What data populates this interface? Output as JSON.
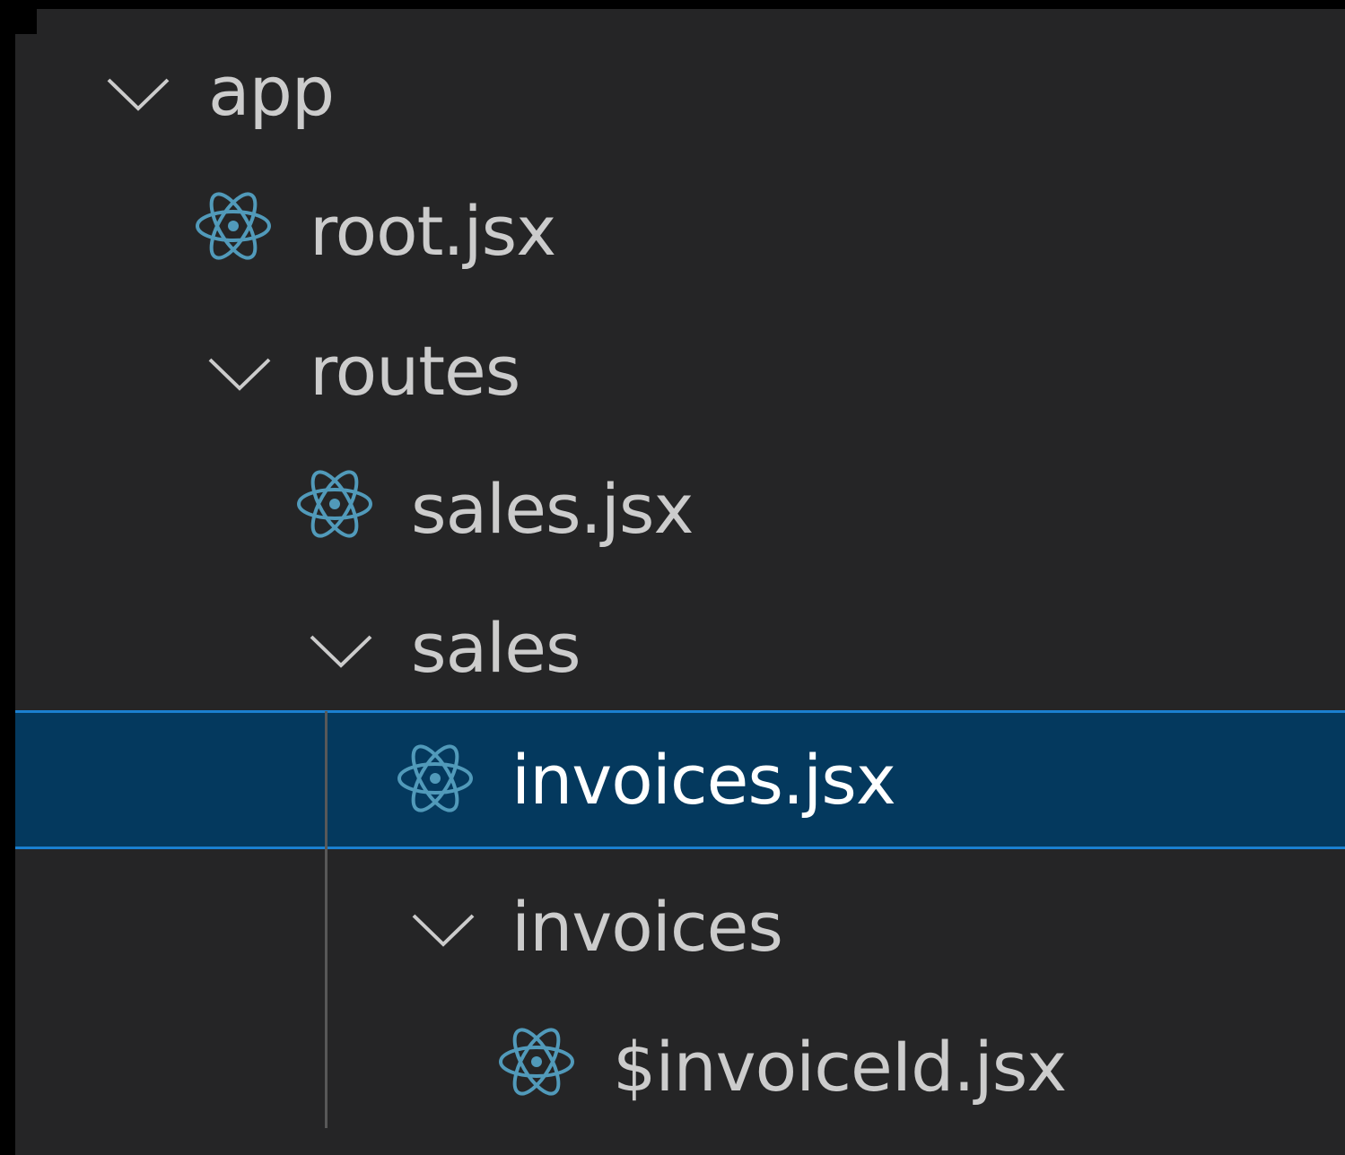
{
  "colors": {
    "background": "#252526",
    "text": "#cccccc",
    "selected_background": "#04395e",
    "selected_border": "#1b80d0",
    "react_icon": "#519aba",
    "indent_guide": "#585858"
  },
  "tree": {
    "app": {
      "label": "app",
      "type": "folder",
      "expanded": true,
      "icon": "chevron-down-icon"
    },
    "root": {
      "label": "root.jsx",
      "type": "file",
      "icon": "react-icon"
    },
    "routes": {
      "label": "routes",
      "type": "folder",
      "expanded": true,
      "icon": "chevron-down-icon"
    },
    "sales_file": {
      "label": "sales.jsx",
      "type": "file",
      "icon": "react-icon"
    },
    "sales_folder": {
      "label": "sales",
      "type": "folder",
      "expanded": true,
      "icon": "chevron-down-icon"
    },
    "invoices_file": {
      "label": "invoices.jsx",
      "type": "file",
      "icon": "react-icon",
      "selected": true
    },
    "invoices_folder": {
      "label": "invoices",
      "type": "folder",
      "expanded": true,
      "icon": "chevron-down-icon"
    },
    "invoice_id": {
      "label": "$invoiceId.jsx",
      "type": "file",
      "icon": "react-icon"
    }
  }
}
